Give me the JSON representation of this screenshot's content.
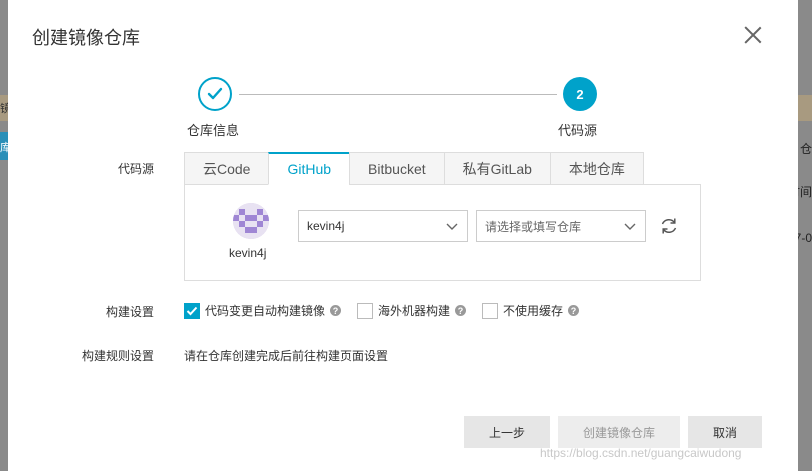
{
  "background": {
    "left_snippets": [
      "镜",
      "库"
    ],
    "right_snippets": [
      "仓",
      "时间",
      "-07-0"
    ]
  },
  "dialog": {
    "title": "创建镜像仓库",
    "close_icon": "close-icon"
  },
  "steps": [
    {
      "label": "仓库信息",
      "state": "done",
      "icon": "checkmark-icon"
    },
    {
      "label": "代码源",
      "state": "active",
      "number": "2"
    }
  ],
  "code_source": {
    "label": "代码源",
    "tabs": [
      {
        "label": "云Code",
        "active": false
      },
      {
        "label": "GitHub",
        "active": true
      },
      {
        "label": "Bitbucket",
        "active": false
      },
      {
        "label": "私有GitLab",
        "active": false
      },
      {
        "label": "本地仓库",
        "active": false
      }
    ],
    "account_name": "kevin4j",
    "user_select_value": "kevin4j",
    "repo_select_placeholder": "请选择或填写仓库",
    "refresh_icon": "refresh-icon"
  },
  "build_settings": {
    "label": "构建设置",
    "options": [
      {
        "label": "代码变更自动构建镜像",
        "checked": true
      },
      {
        "label": "海外机器构建",
        "checked": false
      },
      {
        "label": "不使用缓存",
        "checked": false
      }
    ]
  },
  "build_rules": {
    "label": "构建规则设置",
    "text": "请在仓库创建完成后前往构建页面设置"
  },
  "footer": {
    "prev_label": "上一步",
    "create_label": "创建镜像仓库",
    "cancel_label": "取消"
  },
  "watermark": "https://blog.csdn.net/guangcaiwudong",
  "colors": {
    "accent": "#00a2ca",
    "button_bg": "#e6e6e6"
  }
}
